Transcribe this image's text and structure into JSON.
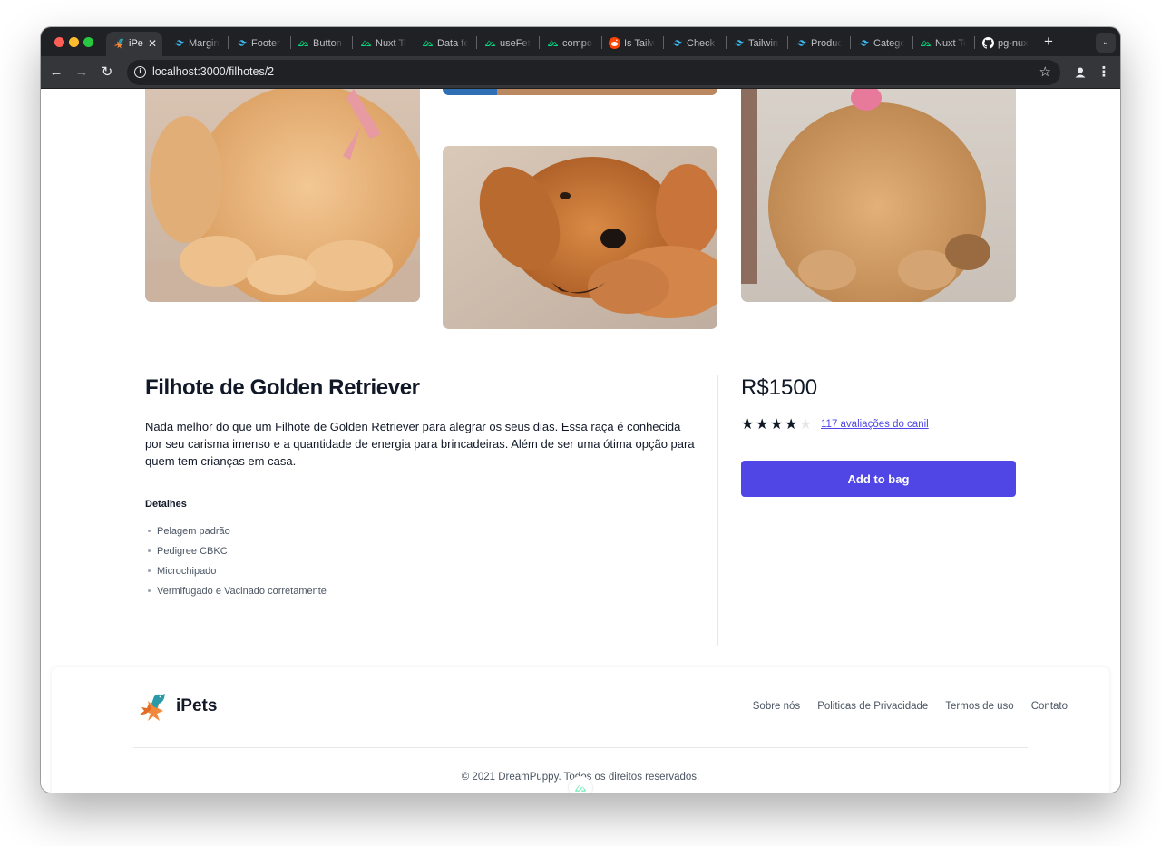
{
  "browser": {
    "active_tab": {
      "title": "iPe",
      "favicon": "ipets-logo-icon"
    },
    "tabs": [
      {
        "title": "Margin",
        "favicon": "tailwind-icon"
      },
      {
        "title": "Footer",
        "favicon": "tailwind-icon"
      },
      {
        "title": "Button",
        "favicon": "nuxt-icon"
      },
      {
        "title": "Nuxt Te",
        "favicon": "nuxt-icon"
      },
      {
        "title": "Data fe",
        "favicon": "nuxt-icon"
      },
      {
        "title": "useFet",
        "favicon": "nuxt-icon"
      },
      {
        "title": "compo",
        "favicon": "nuxt-icon"
      },
      {
        "title": "Is Tailw",
        "favicon": "reddit-icon"
      },
      {
        "title": "Check",
        "favicon": "tailwind-icon"
      },
      {
        "title": "Tailwin",
        "favicon": "tailwind-icon"
      },
      {
        "title": "Produc",
        "favicon": "tailwind-icon"
      },
      {
        "title": "Catego",
        "favicon": "tailwind-icon"
      },
      {
        "title": "Nuxt Te",
        "favicon": "nuxt-icon"
      },
      {
        "title": "pg-nux",
        "favicon": "github-icon"
      }
    ],
    "url": "localhost:3000/filhotes/2",
    "colors": {
      "tabstrip": "#202124",
      "toolbar": "#35363a",
      "tailwind": "#38bdf8",
      "nuxt": "#00dc82",
      "reddit": "#ff4500"
    }
  },
  "product": {
    "title": "Filhote de Golden Retriever",
    "description": "Nada melhor do que um Filhote de Golden Retriever para alegrar os seus dias. Essa raça é conhecida por seu carisma imenso e a quantidade de energia para brincadeiras. Além de ser uma ótima opção para quem tem crianças em casa.",
    "details_heading": "Detalhes",
    "details": [
      "Pelagem padrão",
      "Pedigree CBKC",
      "Microchipado",
      "Vermifugado e Vacinado corretamente"
    ],
    "price": "R$1500",
    "rating": {
      "value": 4,
      "max": 5
    },
    "reviews_link": "117 avaliações do canil",
    "add_to_bag": "Add to bag",
    "accent_color": "#4f46e5"
  },
  "footer": {
    "brand": "iPets",
    "links": [
      "Sobre nós",
      "Politicas de Privacidade",
      "Termos de uso",
      "Contato"
    ],
    "copyright": "© 2021 DreamPuppy. Todos os direitos reservados."
  }
}
